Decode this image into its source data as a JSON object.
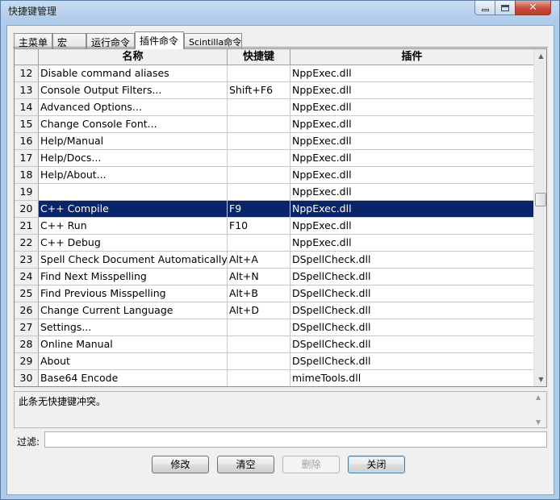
{
  "window": {
    "title": "快捷键管理"
  },
  "tabs": [
    {
      "label": "主菜单"
    },
    {
      "label": "宏"
    },
    {
      "label": "运行命令"
    },
    {
      "label": "插件命令",
      "active": true
    },
    {
      "label": "Scintilla命令"
    }
  ],
  "grid": {
    "columns": {
      "name": "名称",
      "shortcut": "快捷键",
      "plugin": "插件"
    },
    "rows": [
      {
        "num": "12",
        "name": "Disable command aliases",
        "shortcut": "",
        "plugin": "NppExec.dll"
      },
      {
        "num": "13",
        "name": "Console Output Filters...",
        "shortcut": "Shift+F6",
        "plugin": "NppExec.dll"
      },
      {
        "num": "14",
        "name": "Advanced Options...",
        "shortcut": "",
        "plugin": "NppExec.dll"
      },
      {
        "num": "15",
        "name": "Change Console Font...",
        "shortcut": "",
        "plugin": "NppExec.dll"
      },
      {
        "num": "16",
        "name": "Help/Manual",
        "shortcut": "",
        "plugin": "NppExec.dll"
      },
      {
        "num": "17",
        "name": "Help/Docs...",
        "shortcut": "",
        "plugin": "NppExec.dll"
      },
      {
        "num": "18",
        "name": "Help/About...",
        "shortcut": "",
        "plugin": "NppExec.dll"
      },
      {
        "num": "19",
        "name": "",
        "shortcut": "",
        "plugin": "NppExec.dll"
      },
      {
        "num": "20",
        "name": "C++ Compile",
        "shortcut": "F9",
        "plugin": "NppExec.dll",
        "selected": true
      },
      {
        "num": "21",
        "name": "C++ Run",
        "shortcut": "F10",
        "plugin": "NppExec.dll"
      },
      {
        "num": "22",
        "name": "C++ Debug",
        "shortcut": "",
        "plugin": "NppExec.dll"
      },
      {
        "num": "23",
        "name": "Spell Check Document Automatically",
        "shortcut": "Alt+A",
        "plugin": "DSpellCheck.dll"
      },
      {
        "num": "24",
        "name": "Find Next Misspelling",
        "shortcut": "Alt+N",
        "plugin": "DSpellCheck.dll"
      },
      {
        "num": "25",
        "name": "Find Previous Misspelling",
        "shortcut": "Alt+B",
        "plugin": "DSpellCheck.dll"
      },
      {
        "num": "26",
        "name": "Change Current Language",
        "shortcut": "Alt+D",
        "plugin": "DSpellCheck.dll"
      },
      {
        "num": "27",
        "name": "Settings...",
        "shortcut": "",
        "plugin": "DSpellCheck.dll"
      },
      {
        "num": "28",
        "name": "Online Manual",
        "shortcut": "",
        "plugin": "DSpellCheck.dll"
      },
      {
        "num": "29",
        "name": "About",
        "shortcut": "",
        "plugin": "DSpellCheck.dll"
      },
      {
        "num": "30",
        "name": "Base64 Encode",
        "shortcut": "",
        "plugin": "mimeTools.dll"
      }
    ]
  },
  "conflict": {
    "text": "此条无快捷键冲突。"
  },
  "filter": {
    "label": "过滤:",
    "value": ""
  },
  "buttons": {
    "modify": "修改",
    "clear": "清空",
    "delete": "删除",
    "close": "关闭"
  },
  "colors": {
    "selection": "#0a246a",
    "title_bar": "#aecbe9",
    "close_button": "#c23a29"
  }
}
